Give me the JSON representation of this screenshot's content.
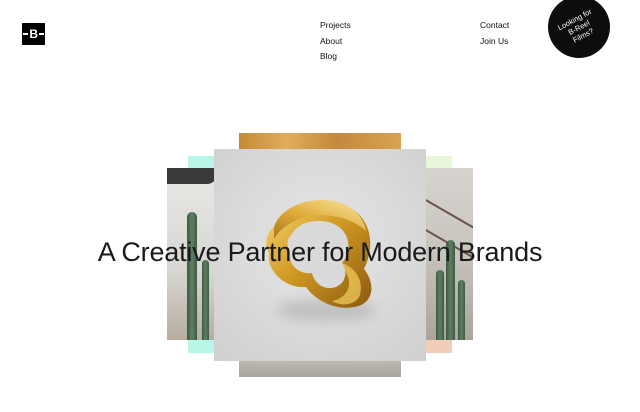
{
  "brand": {
    "logo_text": "B"
  },
  "nav": {
    "col1": [
      "Projects",
      "About",
      "Blog"
    ],
    "col2": [
      "Contact",
      "Join Us"
    ]
  },
  "badge": {
    "text": "Looking for B-Reel Films?"
  },
  "hero": {
    "headline": "A Creative Partner for Modern Brands"
  },
  "colors": {
    "background": "#ffffff",
    "text": "#1a1a1a",
    "badge_bg": "#0d0d0d",
    "accent_cyan": "#b8f7e7",
    "accent_lime": "#e8f6d9",
    "accent_peach": "#f2cdb9",
    "gold": "#d9a53a"
  },
  "images": {
    "front": "gold-ring-render",
    "left": "cactus-interior-photo",
    "right": "stairs-cactus-photo",
    "back": "wooden-panel-photo"
  }
}
